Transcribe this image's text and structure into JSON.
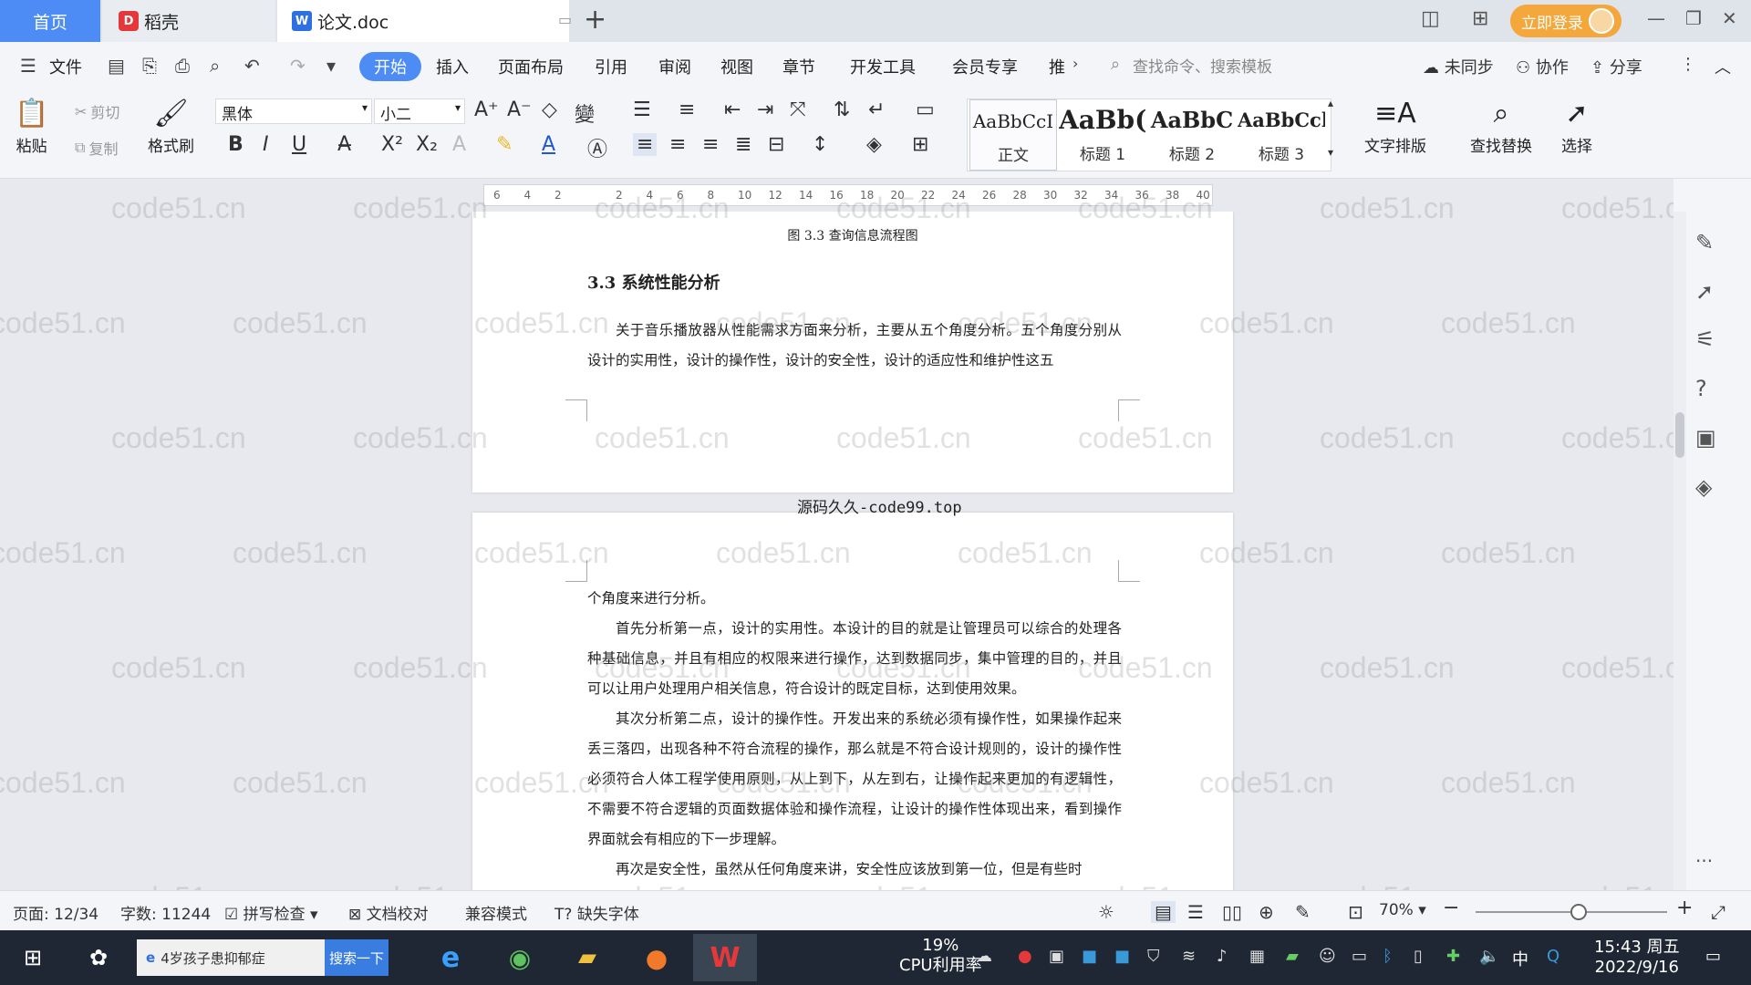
{
  "titlebar": {
    "home_tab": "首页",
    "docer_tab": "稻壳",
    "doc_tab": "论文.doc",
    "login": "立即登录"
  },
  "menubar": {
    "file": "文件",
    "start": "开始",
    "insert": "插入",
    "layout": "页面布局",
    "reference": "引用",
    "review": "审阅",
    "view": "视图",
    "chapter": "章节",
    "devtools": "开发工具",
    "vip": "会员专享",
    "more": "推",
    "search_placeholder": "查找命令、搜索模板",
    "sync": "未同步",
    "collab": "协作",
    "share": "分享"
  },
  "ribbon": {
    "paste": "粘贴",
    "cut": "剪切",
    "copy": "复制",
    "format_painter": "格式刷",
    "font_name": "黑体",
    "font_size": "小二",
    "styles": [
      {
        "sample": "AaBbCcI",
        "name": "正文"
      },
      {
        "sample": "AaBb(",
        "name": "标题 1"
      },
      {
        "sample": "AaBbC",
        "name": "标题 2"
      },
      {
        "sample": "AaBbCcl",
        "name": "标题 3"
      }
    ],
    "text_layout": "文字排版",
    "find_replace": "查找替换",
    "select": "选择"
  },
  "ruler": {
    "ticks": [
      "6",
      "4",
      "2",
      "",
      "2",
      "4",
      "6",
      "8",
      "10",
      "12",
      "14",
      "16",
      "18",
      "20",
      "22",
      "24",
      "26",
      "28",
      "30",
      "32",
      "34",
      "36",
      "38",
      "40"
    ]
  },
  "document": {
    "caption": "图 3.3 查询信息流程图",
    "heading": "3.3  系统性能分析",
    "p1": "关于音乐播放器从性能需求方面来分析，主要从五个角度分析。五个角度分别从设计的实用性，设计的操作性，设计的安全性，设计的适应性和维护性这五",
    "between": "源码久久-code99.top",
    "p2_cont": "个角度来进行分析。",
    "p3": "首先分析第一点，设计的实用性。本设计的目的就是让管理员可以综合的处理各种基础信息，并且有相应的权限来进行操作，达到数据同步，集中管理的目的，并且可以让用户处理用户相关信息，符合设计的既定目标，达到使用效果。",
    "p4": "其次分析第二点，设计的操作性。开发出来的系统必须有操作性，如果操作起来丢三落四，出现各种不符合流程的操作，那么就是不符合设计规则的，设计的操作性必须符合人体工程学使用原则，从上到下，从左到右，让操作起来更加的有逻辑性，不需要不符合逻辑的页面数据体验和操作流程，让设计的操作性体现出来，看到操作界面就会有相应的下一步理解。",
    "p5": "再次是安全性，虽然从任何角度来讲，安全性应该放到第一位，但是有些时"
  },
  "watermark": "code51.cn",
  "statusbar": {
    "page": "页面: 12/34",
    "words": "字数: 11244",
    "spell": "拼写检查",
    "proof": "文档校对",
    "compat": "兼容模式",
    "missing_font": "缺失字体",
    "zoom": "70%"
  },
  "taskbar": {
    "search_text": "4岁孩子患抑郁症",
    "search_btn": "搜索一下",
    "cpu_value": "19%",
    "cpu_label": "CPU利用率",
    "ime": "中",
    "time": "15:43 周五",
    "date": "2022/9/16"
  },
  "colors": {
    "accent": "#4d8cf5",
    "login": "#f4a73a",
    "taskbar": "#1e2733"
  }
}
